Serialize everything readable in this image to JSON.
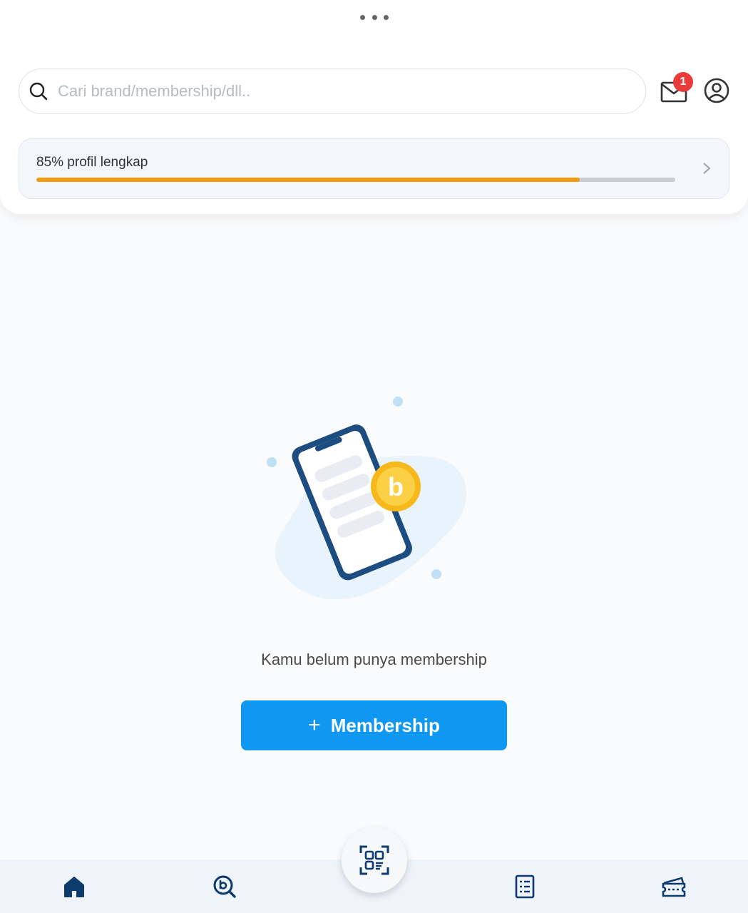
{
  "header": {
    "search": {
      "placeholder": "Cari brand/membership/dll..",
      "value": ""
    },
    "inbox": {
      "badge_count": "1",
      "icon": "mail-icon"
    },
    "profile": {
      "icon": "user-circle-icon"
    }
  },
  "profile_progress": {
    "label": "85% profil lengkap",
    "percent": 85,
    "fill_color": "#f39a13"
  },
  "empty_state": {
    "illustration": "phone-with-coin",
    "message": "Kamu belum punya membership"
  },
  "add_button": {
    "plus": "+",
    "label": "Membership",
    "color": "#0f97f2"
  },
  "bottom_nav": {
    "items": [
      {
        "id": "home",
        "icon": "home-icon",
        "active": true
      },
      {
        "id": "explore",
        "icon": "brand-search-icon"
      },
      {
        "id": "scan",
        "icon": "qr-scan-icon"
      },
      {
        "id": "transactions",
        "icon": "receipt-icon"
      },
      {
        "id": "vouchers",
        "icon": "ticket-icon"
      }
    ]
  },
  "colors": {
    "brand_dark": "#0d3b6e",
    "accent_orange": "#f39a13",
    "badge_red": "#ea3b3b"
  }
}
